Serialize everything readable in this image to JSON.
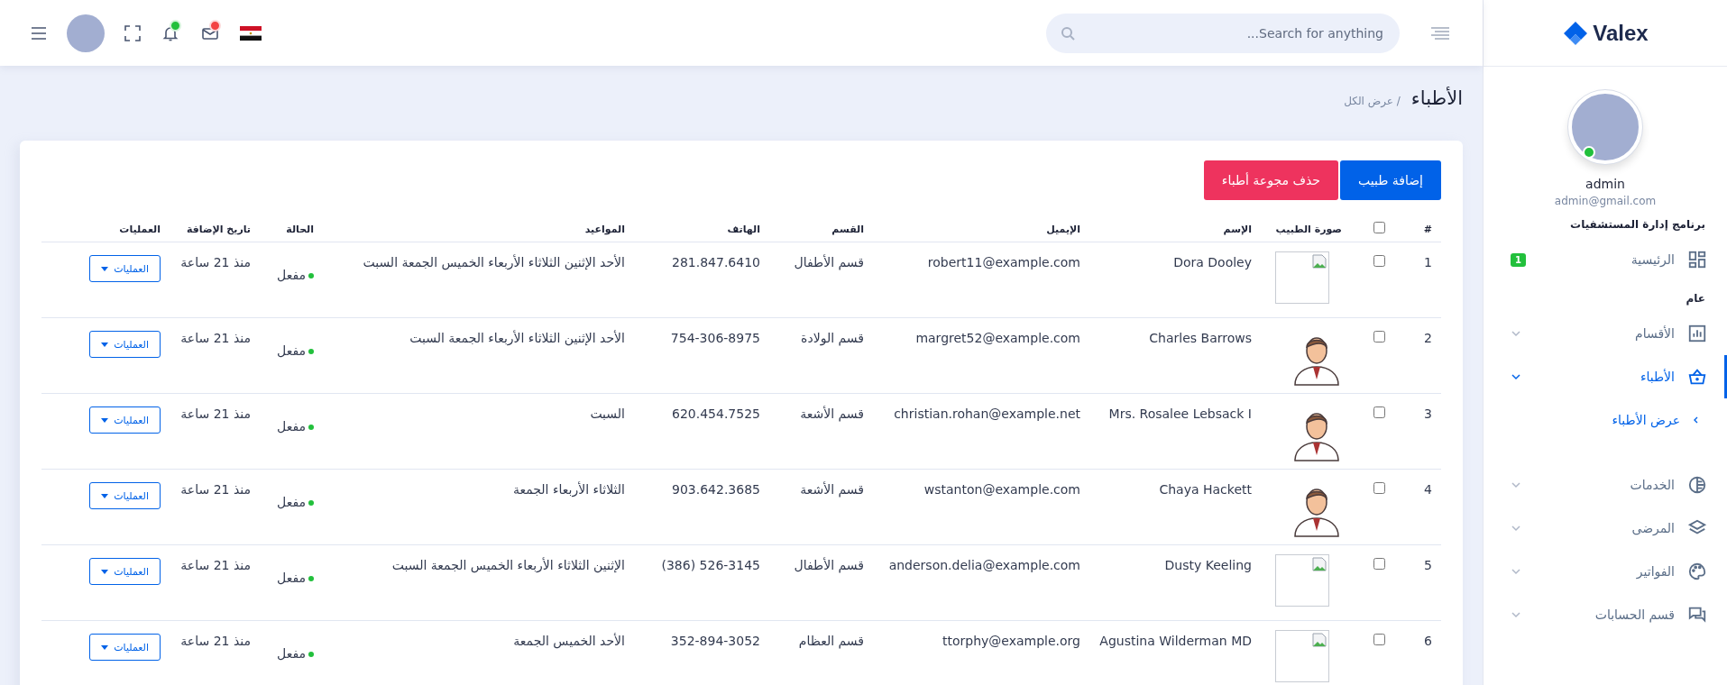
{
  "sidebar": {
    "logo": "Valex",
    "user": {
      "name": "admin",
      "email": "admin@gmail.com",
      "online": true
    },
    "sections": [
      {
        "title": "برنامج إدارة المستشفيات",
        "items": [
          {
            "kind": "link",
            "label": "الرئيسية",
            "badge": "1",
            "selected": false
          }
        ]
      },
      {
        "title": "عام",
        "items": [
          {
            "kind": "menu",
            "label": "الأقسام",
            "selected": false,
            "expanded": false
          },
          {
            "kind": "menu",
            "label": "الأطباء",
            "selected": true,
            "expanded": true,
            "children": [
              {
                "label": "عرض الأطباء",
                "selected": true
              }
            ]
          },
          {
            "kind": "menu",
            "label": "الخدمات",
            "selected": false,
            "expanded": false
          },
          {
            "kind": "menu",
            "label": "المرضى",
            "selected": false,
            "expanded": false
          },
          {
            "kind": "menu",
            "label": "الفواتير",
            "selected": false,
            "expanded": false
          },
          {
            "kind": "menu",
            "label": "قسم الحسابات",
            "selected": false,
            "expanded": false
          }
        ]
      }
    ]
  },
  "header": {
    "search": {
      "placeholder": "Search for anything..."
    },
    "notifications": [
      {
        "kind": "mail",
        "color": "#f34343"
      },
      {
        "kind": "bell",
        "color": "#22c03c"
      }
    ]
  },
  "page": {
    "title": "الأطباء",
    "breadcrumb": "/ عرض الكل"
  },
  "buttons": [
    {
      "kind": "primary",
      "label": "إضافة طبيب"
    },
    {
      "kind": "danger",
      "label": "حذف مجوعة أطباء"
    }
  ],
  "table": {
    "columns": [
      "#",
      "صورة الطبيب",
      "الإسم",
      "الإيميل",
      "القسم",
      "الهاتف",
      "المواعيد",
      "الحالة",
      "تاريخ الإضافة",
      "العمليات"
    ],
    "select_all": {
      "checked": false
    },
    "rows": [
      {
        "number": "1",
        "checked": false,
        "kind": "broken",
        "name": "Dora Dooley",
        "email": "robert11@example.com",
        "department": "قسم الأطفال",
        "phone": "281.847.6410",
        "appointments": "الأحد الإثنين الثلاثاء الأربعاء الخميس الجمعة السبت",
        "active": true,
        "status": "مفعل",
        "added": "منذ 21 ساعة",
        "action": "العمليات"
      },
      {
        "number": "2",
        "checked": false,
        "kind": "avatar",
        "name": "Charles Barrows",
        "email": "margret52@example.com",
        "department": "قسم الولادة",
        "phone": "754-306-8975",
        "appointments": "الأحد الإثنين الثلاثاء الأربعاء الجمعة السبت",
        "active": true,
        "status": "مفعل",
        "added": "منذ 21 ساعة",
        "action": "العمليات"
      },
      {
        "number": "3",
        "checked": false,
        "kind": "avatar",
        "name": "Mrs. Rosalee Lebsack I",
        "email": "christian.rohan@example.net",
        "department": "قسم الأشعة",
        "phone": "620.454.7525",
        "appointments": "السبت",
        "active": true,
        "status": "مفعل",
        "added": "منذ 21 ساعة",
        "action": "العمليات"
      },
      {
        "number": "4",
        "checked": false,
        "kind": "avatar",
        "name": "Chaya Hackett",
        "email": "wstanton@example.com",
        "department": "قسم الأشعة",
        "phone": "903.642.3685",
        "appointments": "الثلاثاء الأربعاء الجمعة",
        "active": true,
        "status": "مفعل",
        "added": "منذ 21 ساعة",
        "action": "العمليات"
      },
      {
        "number": "5",
        "checked": false,
        "kind": "broken",
        "name": "Dusty Keeling",
        "email": "anderson.delia@example.com",
        "department": "قسم الأطفال",
        "phone": "(386) 526-3145",
        "appointments": "الإثنين الثلاثاء الأربعاء الخميس الجمعة السبت",
        "active": true,
        "status": "مفعل",
        "added": "منذ 21 ساعة",
        "action": "العمليات"
      },
      {
        "number": "6",
        "checked": false,
        "kind": "broken",
        "name": "Agustina Wilderman MD",
        "email": "ttorphy@example.org",
        "department": "قسم العظام",
        "phone": "352-894-3052",
        "appointments": "الأحد الخميس الجمعة",
        "active": true,
        "status": "مفعل",
        "added": "منذ 21 ساعة",
        "action": "العمليات"
      }
    ]
  }
}
